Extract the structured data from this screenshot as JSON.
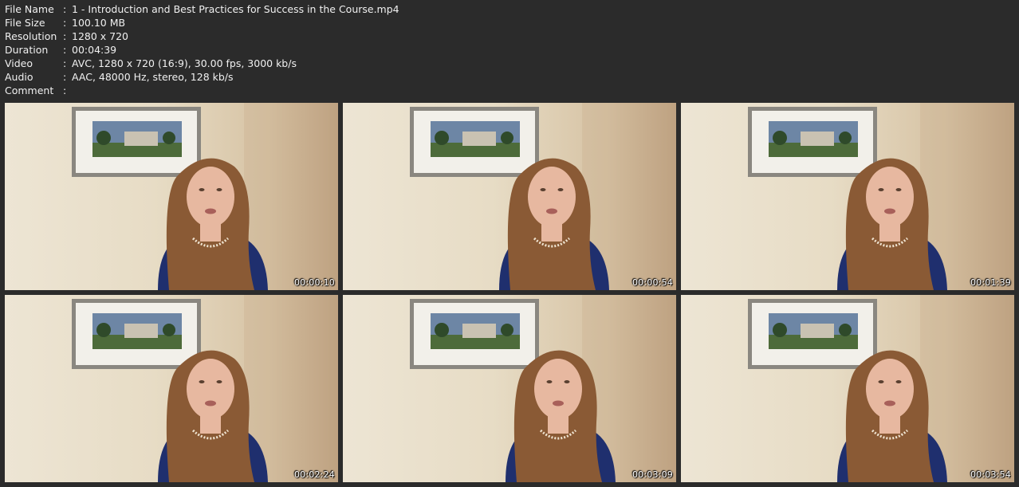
{
  "info": {
    "rows": [
      {
        "key": "File Name",
        "sep": ":",
        "value": "1 - Introduction and Best Practices for Success in the Course.mp4"
      },
      {
        "key": "File Size",
        "sep": ":",
        "value": "100.10 MB"
      },
      {
        "key": "Resolution",
        "sep": ":",
        "value": "1280 x 720"
      },
      {
        "key": "Duration",
        "sep": ":",
        "value": "00:04:39"
      },
      {
        "key": "Video",
        "sep": ":",
        "value": "AVC, 1280 x 720 (16:9), 30.00 fps, 3000 kb/s"
      },
      {
        "key": "Audio",
        "sep": ":",
        "value": "AAC, 48000 Hz, stereo, 128 kb/s"
      },
      {
        "key": "Comment",
        "sep": ":",
        "value": ""
      }
    ]
  },
  "thumbnails": [
    {
      "timestamp": "00:00:10"
    },
    {
      "timestamp": "00:00:54"
    },
    {
      "timestamp": "00:01:39"
    },
    {
      "timestamp": "00:02:24"
    },
    {
      "timestamp": "00:03:09"
    },
    {
      "timestamp": "00:03:54"
    }
  ],
  "colors": {
    "background": "#2b2b2b",
    "text": "#f0f0f0",
    "wall": "#e7dcc5",
    "frame": "#8a8780",
    "hair": "#8a5a35",
    "shirt": "#1f2f6e",
    "skin": "#e7b8a0"
  }
}
